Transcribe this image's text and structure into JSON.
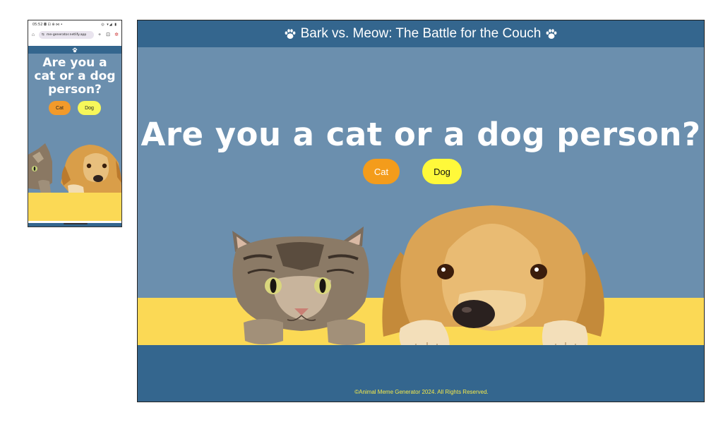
{
  "phone": {
    "status": {
      "time": "05:52",
      "icons": "◘ ⊡ ⊕ ⋈ •",
      "right": "◎ ▾◢ ▮"
    },
    "browser": {
      "url": "me-generator.netlify.app"
    },
    "page": {
      "title": "Are you a cat or a dog person?",
      "cat_label": "Cat",
      "dog_label": "Dog"
    }
  },
  "site": {
    "header_title": "Bark vs. Meow: The Battle for the Couch",
    "hero_title": "Are you a cat or a dog person?",
    "buttons": {
      "cat": "Cat",
      "dog": "Dog"
    },
    "footer": "©Animal Meme Generator 2024. All Rights Reserved."
  },
  "colors": {
    "header": "#34668e",
    "hero_bg": "#6b8fae",
    "counter": "#fbd955",
    "cat_button": "#f49c1b",
    "dog_button": "#fff93a",
    "footer_text": "#f4e94a"
  }
}
